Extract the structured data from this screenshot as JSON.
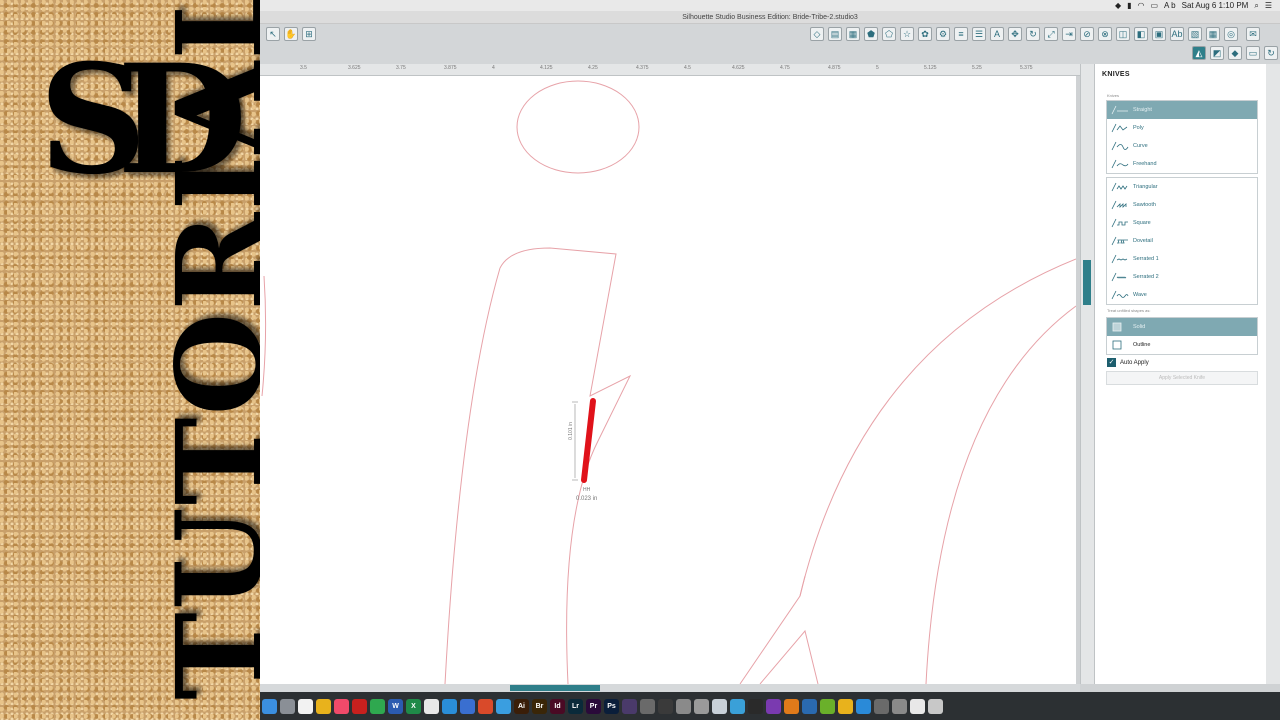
{
  "window": {
    "title": "Silhouette Studio Business Edition: Bride-Tribe-2.studio3"
  },
  "menubar": {
    "date_time": "Sat Aug 6  1:10 PM",
    "keyboard_label": "A b"
  },
  "brand": {
    "logo_text": "SD",
    "word_text": "TUTORIALS"
  },
  "ruler": {
    "labels": [
      "3.5",
      "3.625",
      "3.75",
      "3.875",
      "4",
      "4.125",
      "4.25",
      "4.375",
      "4.5",
      "4.625",
      "4.75",
      "4.875",
      "5",
      "5.125",
      "5.25",
      "5.375"
    ]
  },
  "canvas": {
    "measure_vertical": "0.101 in",
    "measure_horizontal": "0.023 in",
    "measure_label_small": "HH",
    "knife_color": "#e0121a",
    "outline_color": "#e7a2a8"
  },
  "panel": {
    "title": "KNIVES",
    "knives_group_label": "Knives",
    "knives": [
      {
        "label": "Straight",
        "selected": true,
        "icon": "straight-knife-icon"
      },
      {
        "label": "Poly",
        "selected": false,
        "icon": "poly-knife-icon"
      },
      {
        "label": "Curve",
        "selected": false,
        "icon": "curve-knife-icon"
      },
      {
        "label": "Freehand",
        "selected": false,
        "icon": "freehand-knife-icon"
      }
    ],
    "patterns": [
      {
        "label": "Triangular",
        "icon": "triangular-knife-icon"
      },
      {
        "label": "Sawtooth",
        "icon": "sawtooth-knife-icon"
      },
      {
        "label": "Square",
        "icon": "square-knife-icon"
      },
      {
        "label": "Dovetail",
        "icon": "dovetail-knife-icon"
      },
      {
        "label": "Serrated 1",
        "icon": "serrated-knife-icon"
      },
      {
        "label": "Serrated 2",
        "icon": "serrated-knife-icon"
      },
      {
        "label": "Wave",
        "icon": "wave-knife-icon"
      }
    ],
    "treat_label": "Treat unfilled shapes as:",
    "treat_options": [
      {
        "label": "Solid",
        "selected": true,
        "icon": "solid-shape-icon"
      },
      {
        "label": "Outline",
        "selected": false,
        "icon": "outline-shape-icon"
      }
    ],
    "auto_apply_label": "Auto Apply",
    "auto_apply_checked": true,
    "apply_button": "Apply Selected Knife"
  },
  "colors": {
    "accent": "#2f7f8a",
    "selected_row": "#7fa9b2"
  },
  "dock": {
    "apps": [
      {
        "name": "finder-icon",
        "label": "",
        "color": "#3b8fe0"
      },
      {
        "name": "launchpad-icon",
        "label": "",
        "color": "#8a8f96"
      },
      {
        "name": "calendar-icon",
        "label": "",
        "color": "#f2f2f2"
      },
      {
        "name": "chrome-icon",
        "label": "",
        "color": "#e8b21c"
      },
      {
        "name": "music-icon",
        "label": "",
        "color": "#f04a6a"
      },
      {
        "name": "acrobat-icon",
        "label": "",
        "color": "#c8201e"
      },
      {
        "name": "evernote-icon",
        "label": "",
        "color": "#2fa84f"
      },
      {
        "name": "word-icon",
        "label": "W",
        "color": "#2b5bb0"
      },
      {
        "name": "excel-icon",
        "label": "X",
        "color": "#1f8a48"
      },
      {
        "name": "photos-icon",
        "label": "",
        "color": "#e8e8e8"
      },
      {
        "name": "safari-icon",
        "label": "",
        "color": "#2a8ed8"
      },
      {
        "name": "browser-icon",
        "label": "",
        "color": "#3a6fd0"
      },
      {
        "name": "app-icon",
        "label": "",
        "color": "#d94a2a"
      },
      {
        "name": "safari2-icon",
        "label": "",
        "color": "#3a9ee0"
      },
      {
        "name": "illustrator-icon",
        "label": "Ai",
        "color": "#3a1e08"
      },
      {
        "name": "bridge-icon",
        "label": "Br",
        "color": "#3a2608"
      },
      {
        "name": "indesign-icon",
        "label": "Id",
        "color": "#4a0a24"
      },
      {
        "name": "lightroom-icon",
        "label": "Lr",
        "color": "#0a2a3a"
      },
      {
        "name": "premiere-icon",
        "label": "Pr",
        "color": "#2a0a3a"
      },
      {
        "name": "photoshop-icon",
        "label": "Ps",
        "color": "#0a1e3a"
      },
      {
        "name": "app2-icon",
        "label": "",
        "color": "#4a3a6a"
      },
      {
        "name": "app3-icon",
        "label": "",
        "color": "#6a6a6a"
      },
      {
        "name": "app4-icon",
        "label": "",
        "color": "#3a3a3a"
      },
      {
        "name": "app5-icon",
        "label": "",
        "color": "#8a8a8a"
      },
      {
        "name": "preferences-icon",
        "label": "",
        "color": "#9a9a9a"
      },
      {
        "name": "folder-icon",
        "label": "",
        "color": "#c8d0d8"
      },
      {
        "name": "app6-icon",
        "label": "",
        "color": "#3aa0d8"
      },
      {
        "name": "app7-icon",
        "label": "",
        "color": "#2a2a2a"
      },
      {
        "name": "app8-icon",
        "label": "",
        "color": "#7a3ab0"
      },
      {
        "name": "firefox-icon",
        "label": "",
        "color": "#e07a1a"
      },
      {
        "name": "app9-icon",
        "label": "",
        "color": "#2a6ab0"
      },
      {
        "name": "app10-icon",
        "label": "",
        "color": "#6ab02a"
      },
      {
        "name": "chrome2-icon",
        "label": "",
        "color": "#e8b21c"
      },
      {
        "name": "app11-icon",
        "label": "",
        "color": "#2a8ad8"
      },
      {
        "name": "app12-icon",
        "label": "",
        "color": "#6a6a6a"
      },
      {
        "name": "app13-icon",
        "label": "",
        "color": "#8a8a8a"
      },
      {
        "name": "document-icon",
        "label": "",
        "color": "#e8e8e8"
      },
      {
        "name": "trash-icon",
        "label": "",
        "color": "#c8c8c8"
      }
    ]
  }
}
